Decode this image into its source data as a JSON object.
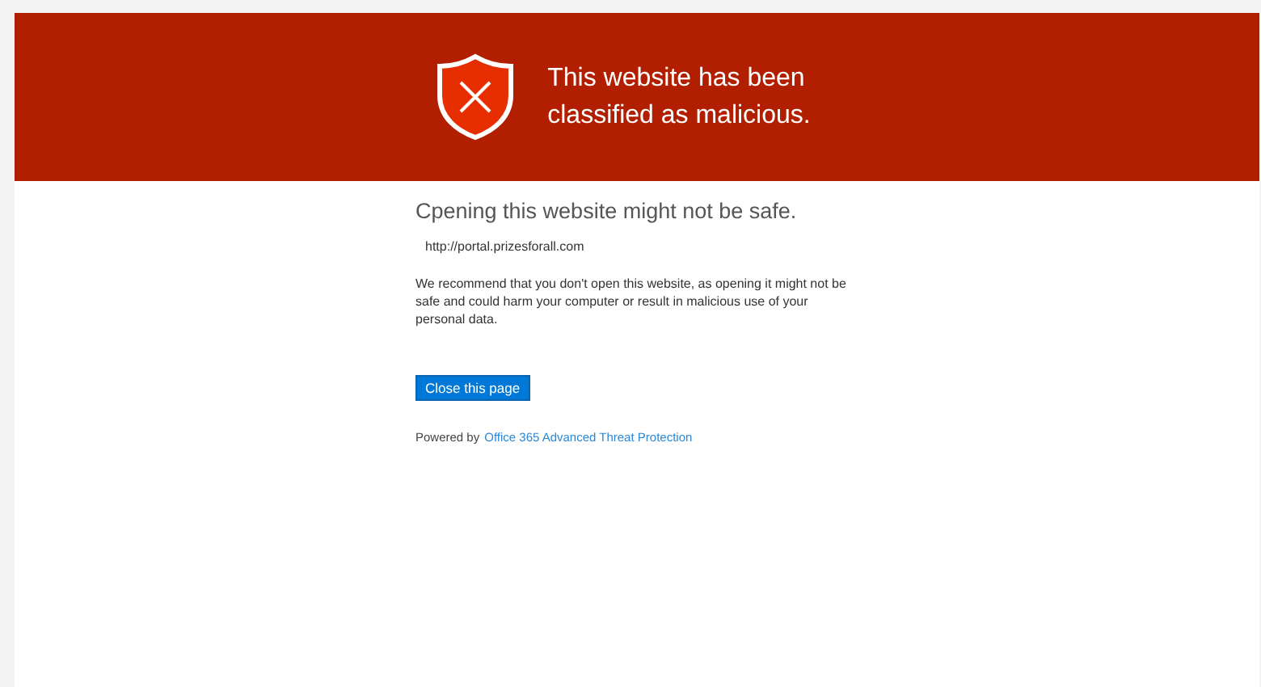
{
  "banner": {
    "title_lines": [
      "This website has been",
      "classified as malicious."
    ]
  },
  "heading": "Cpening this website might not be safe.",
  "url": "http://portal.prizesforall.com",
  "message": "We recommend that you don't open this website, as opening it might not be safe and could harm your computer or result in malicious use of your personal data.",
  "button": "Close this page",
  "footer": {
    "prefix": "Powered by",
    "link": "Office 365 Advanced Threat Protection"
  }
}
